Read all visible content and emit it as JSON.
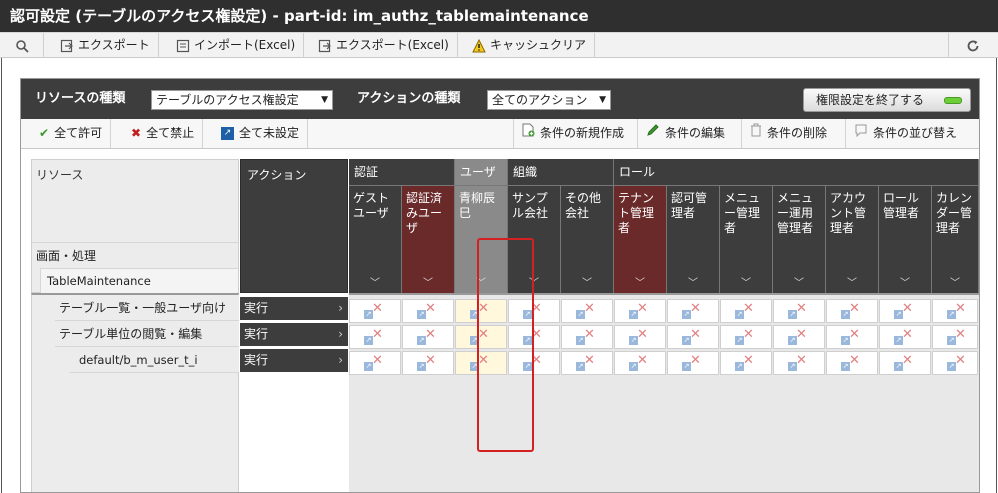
{
  "window": {
    "title": "認可設定 (テーブルのアクセス権設定) - part-id: im_authz_tablemaintenance"
  },
  "main_toolbar": {
    "search_icon": "search-icon",
    "export_label": "エクスポート",
    "import_excel_label": "インポート(Excel)",
    "export_excel_label": "エクスポート(Excel)",
    "cache_clear_label": "キャッシュクリア",
    "refresh_icon": "refresh-icon"
  },
  "panel": {
    "resource_type_label": "リソースの種類",
    "resource_type_value": "テーブルのアクセス権設定",
    "action_type_label": "アクションの種類",
    "action_type_value": "全てのアクション",
    "end_button_label": "権限設定を終了する"
  },
  "panel_toolbar": {
    "allow_all": "全て許可",
    "deny_all": "全て禁止",
    "unset_all": "全て未設定",
    "new_condition": "条件の新規作成",
    "edit_condition": "条件の編集",
    "delete_condition": "条件の削除",
    "sort_condition": "条件の並び替え"
  },
  "grid": {
    "resource_header": "リソース",
    "resource_sub1": "画面・処理",
    "resource_sub2": "TableMaintenance",
    "action_header": "アクション",
    "groups": [
      "認証",
      "ユーザ",
      "組織",
      "ロール"
    ],
    "columns": [
      "ゲストユーザ",
      "認証済みユーザ",
      "青柳辰巳",
      "サンプル会社",
      "その他会社",
      "テナント管理者",
      "認可管理者",
      "メニュー管理者",
      "メニュー運用管理者",
      "アカウント管理者",
      "ロール管理者",
      "カレンダー管理者"
    ],
    "rows": [
      {
        "resource": "テーブル一覧・一般ユーザ向け",
        "action": "実行"
      },
      {
        "resource": "テーブル単位の閲覧・編集",
        "action": "実行"
      },
      {
        "resource": "default/b_m_user_t_i",
        "action": "実行"
      }
    ]
  },
  "colors": {
    "header_dark": "#3d3d3d",
    "role_red": "#6b2a2a",
    "highlight": "#d42020"
  }
}
